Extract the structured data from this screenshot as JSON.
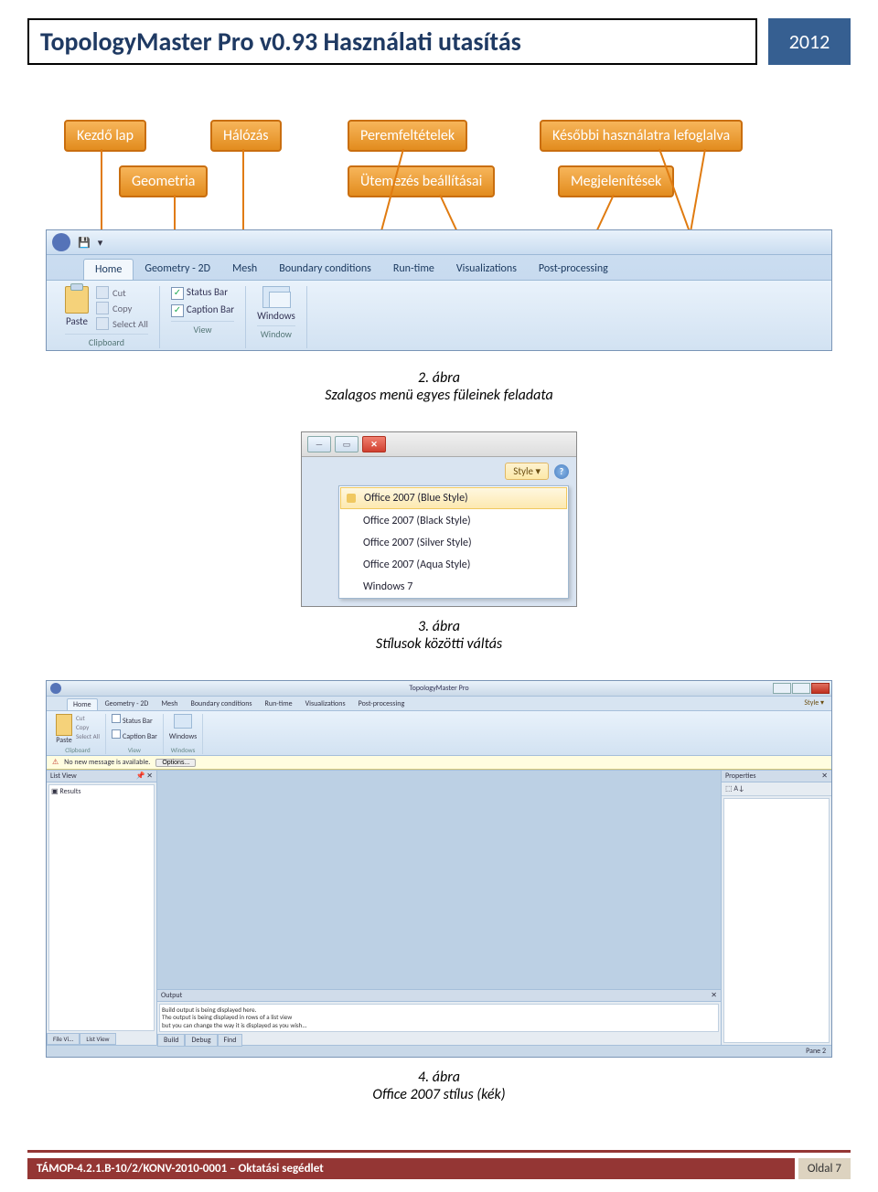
{
  "header": {
    "title": "TopologyMaster Pro v0.93 Használati utasítás",
    "year": "2012"
  },
  "callouts": {
    "r1": [
      {
        "label": "Kezdő lap"
      },
      {
        "label": "Hálózás"
      },
      {
        "label": "Peremfeltételek"
      },
      {
        "label": "Későbbi használatra lefoglalva"
      }
    ],
    "r2": [
      {
        "label": "Geometria"
      },
      {
        "label": "Ütemezés beállításai"
      },
      {
        "label": "Megjelenítések"
      }
    ]
  },
  "ribbon": {
    "tabs": [
      "Home",
      "Geometry - 2D",
      "Mesh",
      "Boundary conditions",
      "Run-time",
      "Visualizations",
      "Post-processing"
    ],
    "paste": "Paste",
    "clip": {
      "cut": "Cut",
      "copy": "Copy",
      "selectAll": "Select All",
      "group": "Clipboard"
    },
    "view": {
      "statusBar": "Status Bar",
      "captionBar": "Caption Bar",
      "group": "View"
    },
    "window": {
      "windows": "Windows",
      "group": "Window"
    }
  },
  "fig2": {
    "num": "2. ábra",
    "caption": "Szalagos menü egyes füleinek feladata"
  },
  "styleMenu": {
    "button": "Style",
    "items": [
      "Office 2007 (Blue Style)",
      "Office 2007 (Black Style)",
      "Office 2007 (Silver Style)",
      "Office 2007 (Aqua Style)",
      "Windows 7"
    ]
  },
  "fig3": {
    "num": "3. ábra",
    "caption": "Stílusok közötti váltás"
  },
  "app": {
    "title": "TopologyMaster Pro",
    "tabs": [
      "Home",
      "Geometry - 2D",
      "Mesh",
      "Boundary conditions",
      "Run-time",
      "Visualizations",
      "Post-processing"
    ],
    "style": "Style",
    "msgbar": {
      "text": "No new message is available.",
      "btn": "Options..."
    },
    "leftTitle": "List View",
    "leftItem": "Results",
    "leftTabs": [
      "File Vi...",
      "List View"
    ],
    "rightTitle": "Properties",
    "outTitle": "Output",
    "outText": "Build output is being displayed here.\nThe output is being displayed in rows of a list view\nbut you can change the way it is displayed as you wish...",
    "outTabs": [
      "Build",
      "Debug",
      "Find"
    ],
    "status": "Pane 2",
    "ribbonGroups": {
      "clipboard": "Clipboard",
      "view": "View",
      "window": "Windows"
    },
    "ribbonItems": {
      "paste": "Paste",
      "cut": "Cut",
      "copy": "Copy",
      "selectAll": "Select All",
      "statusBar": "Status Bar",
      "captionBar": "Caption Bar"
    }
  },
  "fig4": {
    "num": "4. ábra",
    "caption": "Office 2007 stílus (kék)"
  },
  "footer": {
    "left": "TÁMOP-4.2.1.B-10/2/KONV-2010-0001 – Oktatási segédlet",
    "right": "Oldal 7"
  }
}
